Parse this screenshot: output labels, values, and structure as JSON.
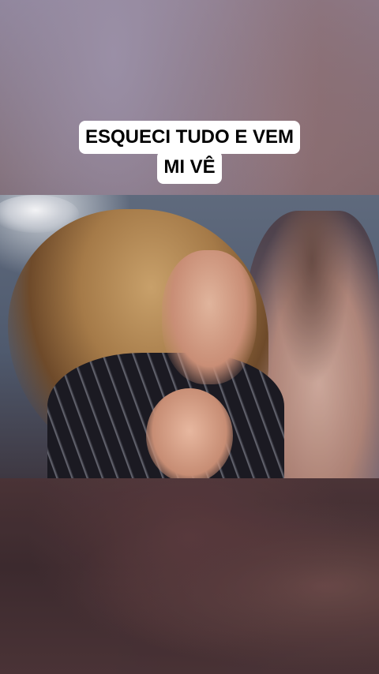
{
  "caption": {
    "line1": "ESQUECI TUDO E VEM",
    "line2": "MI VÊ"
  }
}
